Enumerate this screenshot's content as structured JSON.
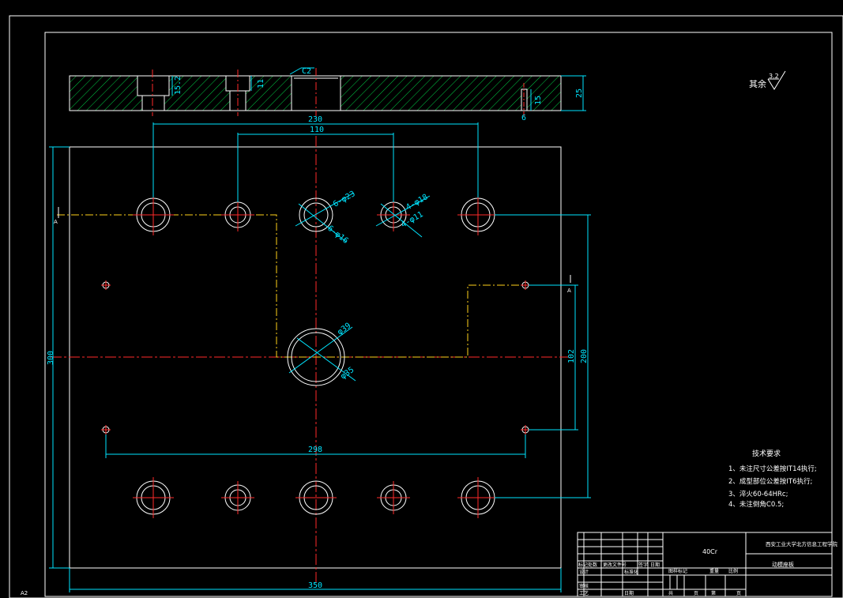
{
  "colors": {
    "background": "#000000",
    "outline": "#ffffff",
    "dimension": "#00e5ff",
    "centerline": "#ff2a2a",
    "phantom": "#ffd21a",
    "hatch": "#00cc44"
  },
  "sheet": {
    "size_label": "A2"
  },
  "section_view": {
    "chamfer_label": "C2",
    "dims": {
      "d15_2": "15.2",
      "d11": "11",
      "d25": "25",
      "d15": "15",
      "d6": "6"
    }
  },
  "plan_view": {
    "dims": {
      "top_outer": "230",
      "top_inner": "110",
      "left_height": "300",
      "right_102": "102",
      "right_200": "200",
      "bottom_298": "298",
      "overall_width": "350"
    },
    "callouts": {
      "hole_a": "6-φ23",
      "hole_a2": "6-φ16",
      "hole_b": "4-φ18",
      "hole_b2": "4-φ11",
      "center_outer": "φ39",
      "center_inner": "φ35"
    },
    "section_marker": "A"
  },
  "surface_note": {
    "prefix": "其余",
    "value": "3.2"
  },
  "tech_requirements": {
    "title": "技术要求",
    "items": [
      "1、未注尺寸公差按IT14执行;",
      "2、成型部位公差按IT6执行;",
      "3、淬火60-64HRc;",
      "4、未注倒角C0.5;"
    ]
  },
  "title_block": {
    "material": "40Cr",
    "school": "西安工业大学北方信息工程学院",
    "part_name": "动模座板",
    "headers": [
      "标记",
      "处数",
      "更改文件号",
      "签字",
      "日期"
    ],
    "roles": [
      "设计",
      "标准化",
      "审核",
      "工艺",
      "日期"
    ],
    "stage_labels": [
      "图样标记",
      "重量",
      "比例"
    ],
    "sheet_labels": [
      "共",
      "页",
      "第",
      "页"
    ]
  }
}
